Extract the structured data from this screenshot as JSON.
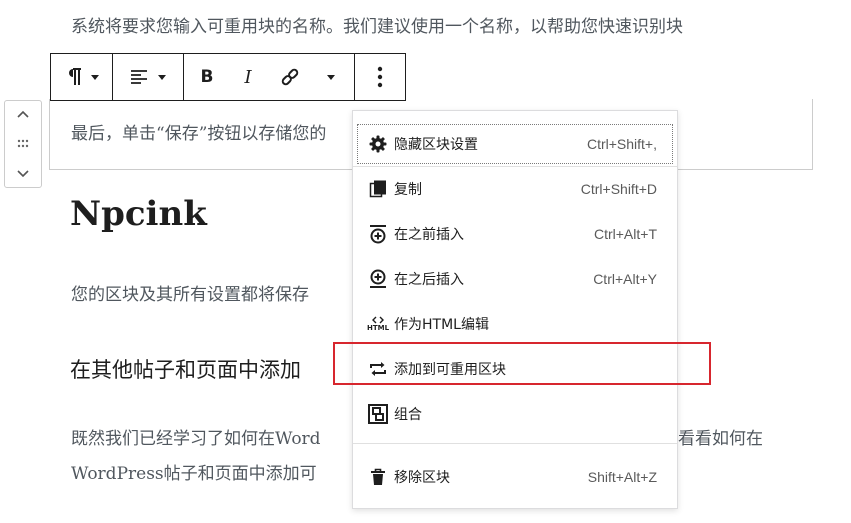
{
  "content": {
    "para_top": "系统将要求您输入可重用块的名称。我们建议使用一个名称，以帮助您快速识别块",
    "selected_block_text": "最后，单击“保存”按钮以存储您的",
    "heading_main": "Npcink",
    "para_saved": "您的区块及其所有设置都将保存",
    "heading_section": "在其他帖子和页面中添加",
    "para_lower_1a": "既然我们已经学习了如何在Word",
    "para_lower_1b": "看看如何在",
    "para_lower_2": "WordPress帖子和页面中添加可"
  },
  "toolbar": {
    "icons": [
      "paragraph-icon",
      "align-left-icon",
      "bold-icon",
      "italic-icon",
      "link-icon",
      "chevron-down-icon",
      "more-options-icon"
    ],
    "labels": {
      "bold": "B",
      "italic": "I"
    }
  },
  "menu": {
    "items": [
      {
        "label": "隐藏区块设置",
        "shortcut": "Ctrl+Shift+,",
        "icon": "gear-icon"
      },
      {
        "label": "复制",
        "shortcut": "Ctrl+Shift+D",
        "icon": "duplicate-icon"
      },
      {
        "label": "在之前插入",
        "shortcut": "Ctrl+Alt+T",
        "icon": "insert-before-icon"
      },
      {
        "label": "在之后插入",
        "shortcut": "Ctrl+Alt+Y",
        "icon": "insert-after-icon"
      },
      {
        "label": "作为HTML编辑",
        "shortcut": "",
        "icon": "html-icon",
        "icon_text": "HTML"
      },
      {
        "label": "添加到可重用区块",
        "shortcut": "",
        "icon": "reusable-block-icon"
      },
      {
        "label": "组合",
        "shortcut": "",
        "icon": "group-icon"
      },
      {
        "label": "移除区块",
        "shortcut": "Shift+Alt+Z",
        "icon": "trash-icon"
      }
    ]
  },
  "colors": {
    "highlight": "#d7262e",
    "text": "#1e1e1e"
  }
}
